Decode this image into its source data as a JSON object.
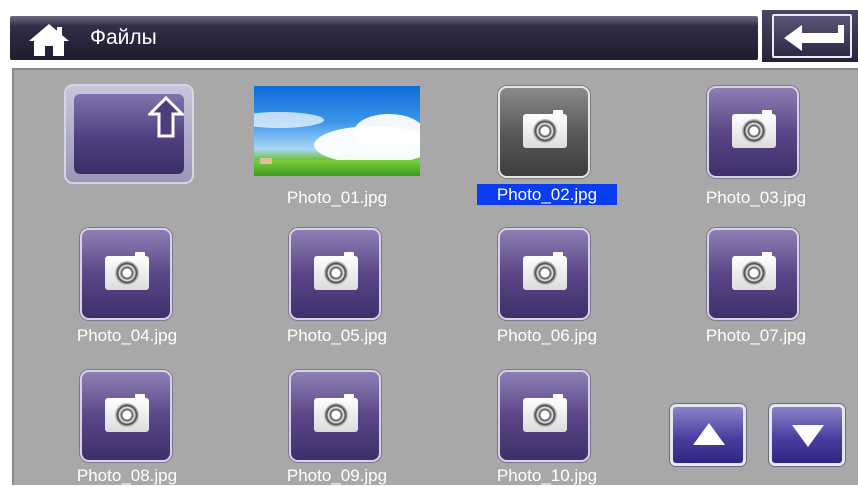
{
  "header": {
    "title": "Файлы",
    "home_icon": "home-icon",
    "back_icon": "return-arrow-icon"
  },
  "files": [
    {
      "label": "Photo_01.jpg",
      "kind": "image-thumbnail",
      "selected": false
    },
    {
      "label": "Photo_02.jpg",
      "kind": "camera-icon",
      "selected": true
    },
    {
      "label": "Photo_03.jpg",
      "kind": "camera-icon",
      "selected": false
    },
    {
      "label": "Photo_04.jpg",
      "kind": "camera-icon",
      "selected": false
    },
    {
      "label": "Photo_05.jpg",
      "kind": "camera-icon",
      "selected": false
    },
    {
      "label": "Photo_06.jpg",
      "kind": "camera-icon",
      "selected": false
    },
    {
      "label": "Photo_07.jpg",
      "kind": "camera-icon",
      "selected": false
    },
    {
      "label": "Photo_08.jpg",
      "kind": "camera-icon",
      "selected": false
    },
    {
      "label": "Photo_09.jpg",
      "kind": "camera-icon",
      "selected": false
    },
    {
      "label": "Photo_10.jpg",
      "kind": "camera-icon",
      "selected": false
    }
  ],
  "nav": {
    "up_folder_icon": "folder-up-icon",
    "scroll_up_icon": "arrow-up-icon",
    "scroll_down_icon": "arrow-down-icon"
  },
  "colors": {
    "selection": "#0a3cf0",
    "panel": "#a8a8a8",
    "header": "#2b2840",
    "icon_purple": "#5a4688"
  }
}
